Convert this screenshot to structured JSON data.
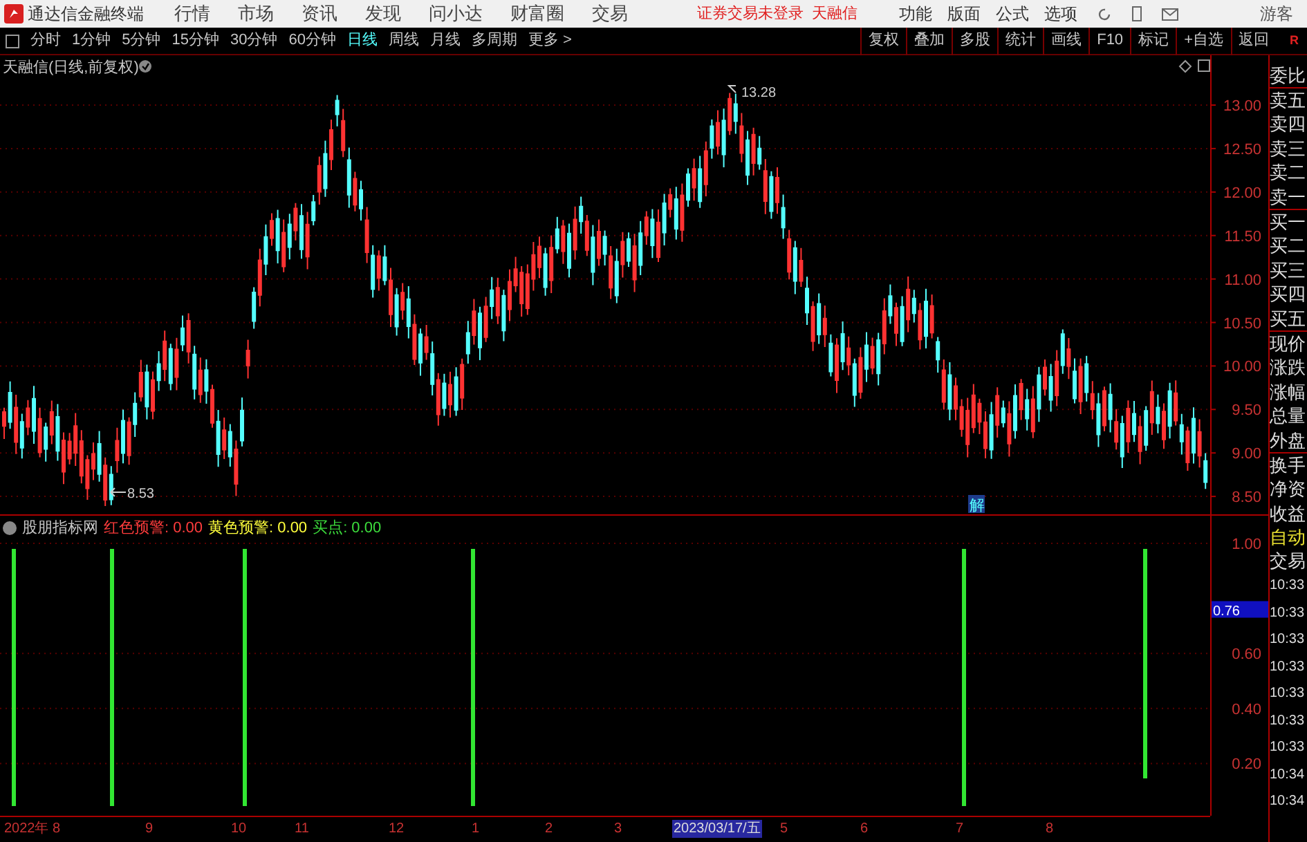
{
  "menubar": {
    "app_name": "通达信金融终端",
    "menus": [
      "行情",
      "市场",
      "资讯",
      "发现",
      "问小达",
      "财富圈",
      "交易"
    ],
    "status": [
      "证券交易未登录",
      "天融信"
    ],
    "right_menus": [
      "功能",
      "版面",
      "公式",
      "选项"
    ],
    "user": "游客"
  },
  "toolbar": {
    "periods": [
      {
        "label": "分时",
        "selected": false
      },
      {
        "label": "1分钟",
        "selected": false
      },
      {
        "label": "5分钟",
        "selected": false
      },
      {
        "label": "15分钟",
        "selected": false
      },
      {
        "label": "30分钟",
        "selected": false
      },
      {
        "label": "60分钟",
        "selected": false
      },
      {
        "label": "日线",
        "selected": true
      },
      {
        "label": "周线",
        "selected": false
      },
      {
        "label": "月线",
        "selected": false
      },
      {
        "label": "多周期",
        "selected": false
      }
    ],
    "more": "更多 >",
    "buttons": [
      "复权",
      "叠加",
      "多股",
      "统计",
      "画线",
      "F10",
      "标记",
      "+自选",
      "返回"
    ],
    "r_label": "R"
  },
  "price_chart": {
    "title": "天融信(日线,前复权)",
    "high_label": "13.28",
    "low_label": "8.53",
    "badge": "解",
    "y_labels": [
      "13.00",
      "12.50",
      "12.00",
      "11.50",
      "11.00",
      "10.50",
      "10.00",
      "9.50",
      "9.00",
      "8.50"
    ]
  },
  "indicator": {
    "name": "股朋指标网",
    "legend": [
      {
        "label": "红色预警:",
        "value": "0.00",
        "color": "#ff3c3c"
      },
      {
        "label": "黄色预警:",
        "value": "0.00",
        "color": "#ffff3c"
      },
      {
        "label": "买点:",
        "value": "0.00",
        "color": "#3cdc3c"
      }
    ],
    "current_value": "0.76",
    "y_labels": [
      "1.00",
      "0.60",
      "0.40",
      "0.20"
    ]
  },
  "date_axis": {
    "labels": [
      {
        "label": "2022年",
        "selected": false
      },
      {
        "label": "8",
        "selected": false
      },
      {
        "label": "9",
        "selected": false
      },
      {
        "label": "10",
        "selected": false
      },
      {
        "label": "11",
        "selected": false
      },
      {
        "label": "12",
        "selected": false
      },
      {
        "label": "1",
        "selected": false
      },
      {
        "label": "2",
        "selected": false
      },
      {
        "label": "3",
        "selected": false
      },
      {
        "label": "2023/03/17/五",
        "selected": true
      },
      {
        "label": "5",
        "selected": false
      },
      {
        "label": "6",
        "selected": false
      },
      {
        "label": "7",
        "selected": false
      },
      {
        "label": "8",
        "selected": false
      }
    ]
  },
  "side_panel": {
    "labels": [
      "委比",
      "卖五",
      "卖四",
      "卖三",
      "卖二",
      "卖一",
      "买一",
      "买二",
      "买三",
      "买四",
      "买五",
      "现价",
      "涨跌",
      "涨幅",
      "总量",
      "外盘",
      "换手",
      "净资",
      "收益"
    ],
    "auto": "自动",
    "trade": "交易",
    "times": [
      "10:33",
      "10:33",
      "10:33",
      "10:33",
      "10:33",
      "10:33",
      "10:33",
      "10:34",
      "10:34"
    ]
  }
}
